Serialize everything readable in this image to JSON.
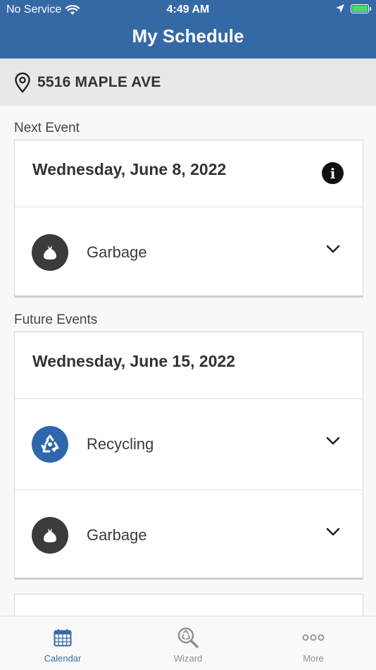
{
  "status_bar": {
    "carrier": "No Service",
    "time": "4:49 AM"
  },
  "header": {
    "title": "My Schedule"
  },
  "address": {
    "text": "5516 MAPLE AVE"
  },
  "next_event": {
    "section_label": "Next Event",
    "date": "Wednesday, June 8, 2022",
    "items": [
      {
        "label": "Garbage",
        "icon": "garbage-bag-icon"
      }
    ]
  },
  "future_events": {
    "section_label": "Future Events",
    "date": "Wednesday, June 15, 2022",
    "items": [
      {
        "label": "Recycling",
        "icon": "recycle-icon"
      },
      {
        "label": "Garbage",
        "icon": "garbage-bag-icon"
      }
    ]
  },
  "tabs": [
    {
      "label": "Calendar",
      "icon": "calendar-icon",
      "active": true
    },
    {
      "label": "Wizard",
      "icon": "wizard-search-icon",
      "active": false
    },
    {
      "label": "More",
      "icon": "more-dots-icon",
      "active": false
    }
  ],
  "colors": {
    "header_blue": "#3569a6",
    "recycle_blue": "#2f67ad",
    "garbage_dark": "#3b3b3b",
    "battery_green": "#4cd964"
  }
}
